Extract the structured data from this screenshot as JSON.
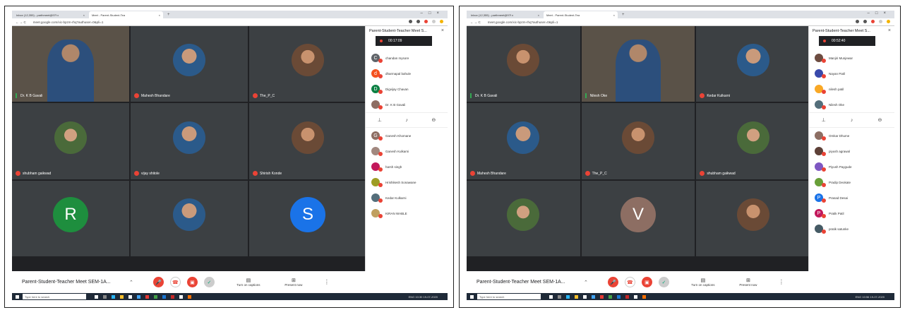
{
  "screens": [
    {
      "tabs": [
        "Inbox (12,355) - parthmeet@97f x",
        "Meet - Parent-Student-Tea"
      ],
      "url": "meet.google.com/xic-bpzm-rhq?authuser=0&pli=1",
      "panel_title": "Parent-Student-Teacher Meet S...",
      "rec_time": "00:17:09",
      "meeting_title": "Parent-Student-Teacher Meet SEM-1A...",
      "captions": "Turn on captions",
      "present": "Present now",
      "search": "Type here to search",
      "clock": "10:30",
      "date": "19-07-2020",
      "lang": "ENG",
      "tiles": [
        {
          "name": "Dr. K B Gavali",
          "kind": "video",
          "mic": "on"
        },
        {
          "name": "Mahesh Bhandare",
          "kind": "photo",
          "mic": "off"
        },
        {
          "name": "The_P_C",
          "kind": "photo2",
          "mic": "off"
        },
        {
          "name": "shubham gaikwad",
          "kind": "photo3",
          "mic": "off"
        },
        {
          "name": "vijay shitole",
          "kind": "photo",
          "mic": "off"
        },
        {
          "name": "Shirish Konde",
          "kind": "photo2",
          "mic": "off"
        },
        {
          "name": "",
          "kind": "letter",
          "letter": "R",
          "color": "#1e8e3e",
          "mic": "off"
        },
        {
          "name": "",
          "kind": "photo",
          "mic": "off"
        },
        {
          "name": "",
          "kind": "letter",
          "letter": "S",
          "color": "#1a73e8",
          "mic": "off"
        }
      ],
      "participants_top": [
        {
          "name": "chandan mysore",
          "letter": "C",
          "color": "#5f6368"
        },
        {
          "name": "dharmapal bahule",
          "letter": "d",
          "color": "#f4511e"
        },
        {
          "name": "Digvijay Chavan",
          "letter": "D",
          "color": "#0b8043"
        },
        {
          "name": "Dr. K B Gavali",
          "letter": "",
          "color": "#8d6e63"
        }
      ],
      "participants_bottom": [
        {
          "name": "Ganesh Khomane",
          "letter": "G",
          "color": "#8d6e63"
        },
        {
          "name": "Ganesh Kulkarni",
          "letter": "",
          "color": "#a1887f"
        },
        {
          "name": "harsh singh",
          "letter": "",
          "color": "#c2185b"
        },
        {
          "name": "Hrishikesh Sonawane",
          "letter": "",
          "color": "#9e9d24"
        },
        {
          "name": "Kedar Kulkarni",
          "letter": "",
          "color": "#546e7a"
        },
        {
          "name": "KIRAN WABLE",
          "letter": "",
          "color": "#c0a060"
        }
      ]
    },
    {
      "tabs": [
        "Inbox (12,355) - parthmeet@97f x",
        "Meet - Parent-Student-Tea"
      ],
      "url": "meet.google.com/xic-bpzm-rhq?authuser=0&pli=1",
      "panel_title": "Parent-Student-Teacher Meet S...",
      "rec_time": "00:52:40",
      "meeting_title": "Parent-Student-Teacher Meet SEM-1A...",
      "captions": "Turn on captions",
      "present": "Present now",
      "search": "Type here to search",
      "clock": "10:56",
      "date": "19-07-2020",
      "lang": "ENG",
      "tiles": [
        {
          "name": "Dr. K B Gavali",
          "kind": "photo2",
          "mic": "on"
        },
        {
          "name": "Nilesh Oke",
          "kind": "video",
          "mic": "on"
        },
        {
          "name": "Kedar Kulkarni",
          "kind": "photo",
          "mic": "off"
        },
        {
          "name": "Mahesh Bhandare",
          "kind": "photo",
          "mic": "off"
        },
        {
          "name": "The_P_C",
          "kind": "photo2",
          "mic": "off"
        },
        {
          "name": "shubham gaikwad",
          "kind": "photo3",
          "mic": "off"
        },
        {
          "name": "",
          "kind": "photo3",
          "mic": "off"
        },
        {
          "name": "",
          "kind": "letter",
          "letter": "V",
          "color": "#8d6e63",
          "mic": "off"
        },
        {
          "name": "",
          "kind": "photo2",
          "mic": "off"
        }
      ],
      "participants_top": [
        {
          "name": "Manjiri Munjewar",
          "letter": "",
          "color": "#6d4c41"
        },
        {
          "name": "Nayan Patil",
          "letter": "",
          "color": "#3949ab"
        },
        {
          "name": "nilesh patil",
          "letter": "",
          "color": "#f9a825"
        },
        {
          "name": "Nilesh Oke",
          "letter": "",
          "color": "#546e7a"
        }
      ],
      "participants_bottom": [
        {
          "name": "Omkar Dhume",
          "letter": "",
          "color": "#8d6e63"
        },
        {
          "name": "piyush agrawal",
          "letter": "",
          "color": "#5d4037"
        },
        {
          "name": "Piyush Paygude",
          "letter": "",
          "color": "#7e57c2"
        },
        {
          "name": "Pradip Deokate",
          "letter": "",
          "color": "#689f38"
        },
        {
          "name": "Prasad Desai",
          "letter": "P",
          "color": "#1a73e8"
        },
        {
          "name": "Pratik Patil",
          "letter": "P",
          "color": "#c2185b"
        },
        {
          "name": "pratik satunke",
          "letter": "",
          "color": "#455a64"
        }
      ]
    }
  ]
}
